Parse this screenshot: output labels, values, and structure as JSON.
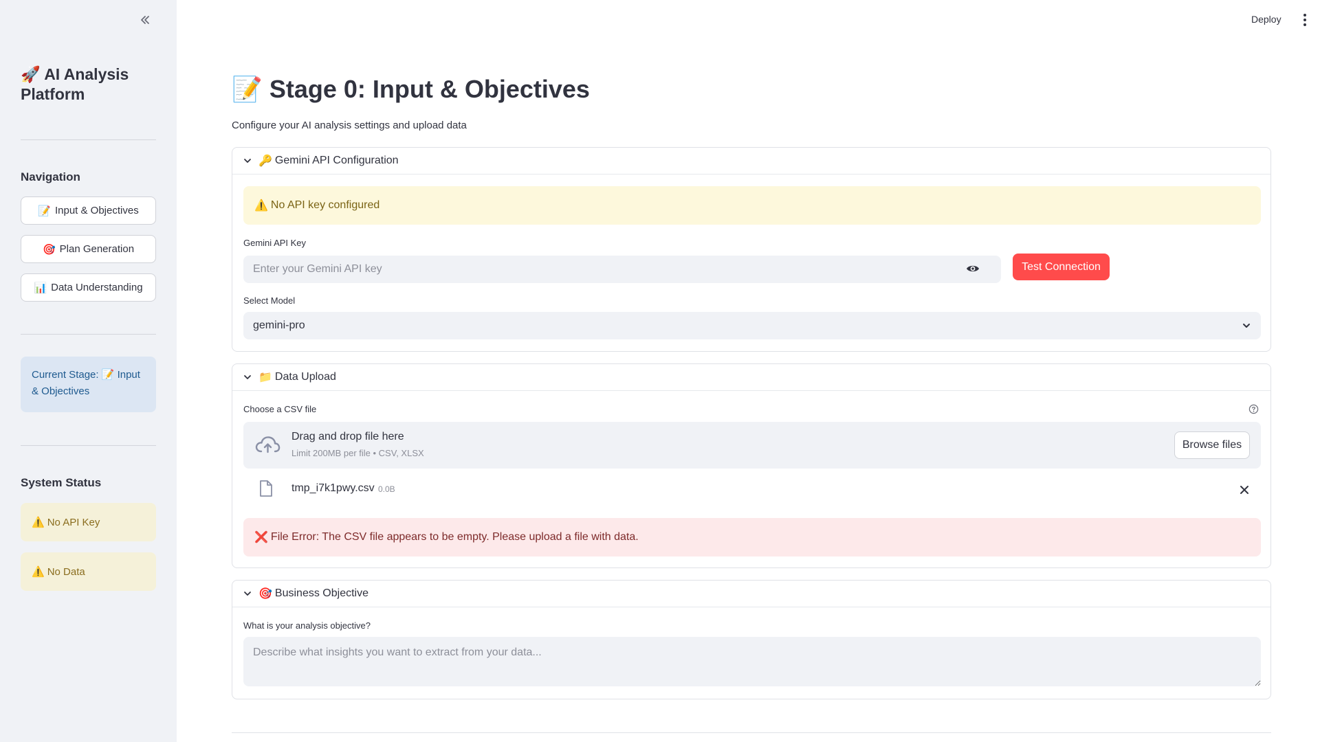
{
  "sidebar": {
    "app_title_emoji": "🚀",
    "app_title": "AI Analysis Platform",
    "navigation_heading": "Navigation",
    "nav_items": [
      {
        "emoji": "📝",
        "label": "Input & Objectives"
      },
      {
        "emoji": "🎯",
        "label": "Plan Generation"
      },
      {
        "emoji": "📊",
        "label": "Data Understanding"
      }
    ],
    "current_stage_label": "Current Stage:",
    "current_stage_value": "📝 Input & Objectives",
    "system_status_heading": "System Status",
    "status_items": [
      {
        "emoji": "⚠️",
        "label": "No API Key"
      },
      {
        "emoji": "⚠️",
        "label": "No Data"
      }
    ]
  },
  "topbar": {
    "deploy_label": "Deploy"
  },
  "main": {
    "title_emoji": "📝",
    "title": "Stage 0: Input & Objectives",
    "subtitle": "Configure your AI analysis settings and upload data",
    "api_section": {
      "emoji": "🔑",
      "title": "Gemini API Configuration",
      "warning_emoji": "⚠️",
      "warning": "No API key configured",
      "api_key_label": "Gemini API Key",
      "api_key_placeholder": "Enter your Gemini API key",
      "api_key_value": "",
      "test_button": "Test Connection",
      "model_label": "Select Model",
      "model_value": "gemini-pro"
    },
    "upload_section": {
      "emoji": "📁",
      "title": "Data Upload",
      "file_label": "Choose a CSV file",
      "dropzone_title": "Drag and drop file here",
      "dropzone_limit": "Limit 200MB per file • CSV, XLSX",
      "browse_button": "Browse files",
      "uploaded_file_name": "tmp_i7k1pwy.csv",
      "uploaded_file_size": "0.0B",
      "error_emoji": "❌",
      "error": "File Error: The CSV file appears to be empty. Please upload a file with data."
    },
    "objective_section": {
      "emoji": "🎯",
      "title": "Business Objective",
      "question_label": "What is your analysis objective?",
      "placeholder": "Describe what insights you want to extract from your data...",
      "value": ""
    }
  },
  "colors": {
    "primary": "#ff4b4b",
    "sidebar_bg": "#f0f2f6",
    "info_bg": "#dce6f3",
    "warning_bg": "#fdf8dc",
    "error_bg": "#fde9ea"
  },
  "icons": {
    "collapse": "double-chevron-left-icon",
    "menu": "kebab-menu-icon",
    "expander": "chevron-down-icon",
    "visibility": "eye-icon",
    "select": "chevron-down-icon",
    "upload": "cloud-upload-icon",
    "help": "help-circle-icon",
    "file": "file-icon",
    "remove": "close-icon"
  }
}
